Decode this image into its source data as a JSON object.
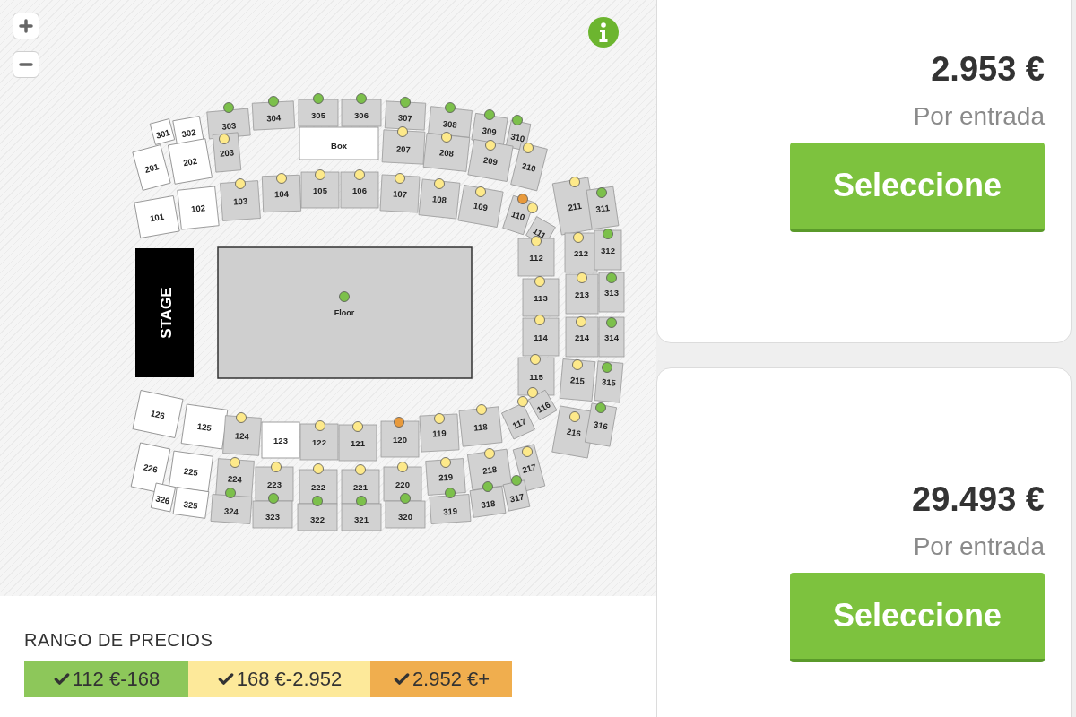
{
  "map": {
    "stage": {
      "label": "STAGE"
    },
    "floor": {
      "label": "Floor",
      "color": "#7cc04b"
    },
    "sections": [
      {
        "label": "301",
        "available": false
      },
      {
        "label": "302",
        "available": false
      },
      {
        "label": "303",
        "available": true,
        "color": "#7cc04b"
      },
      {
        "label": "304",
        "available": true,
        "color": "#7cc04b"
      },
      {
        "label": "305",
        "available": true,
        "color": "#7cc04b"
      },
      {
        "label": "306",
        "available": true,
        "color": "#7cc04b"
      },
      {
        "label": "307",
        "available": true,
        "color": "#7cc04b"
      },
      {
        "label": "308",
        "available": true,
        "color": "#7cc04b"
      },
      {
        "label": "309",
        "available": true,
        "color": "#7cc04b"
      },
      {
        "label": "310",
        "available": true,
        "color": "#7cc04b"
      },
      {
        "label": "201",
        "available": false
      },
      {
        "label": "202",
        "available": false
      },
      {
        "label": "203",
        "available": true,
        "color": "#fde98a"
      },
      {
        "label": "Box",
        "available": false
      },
      {
        "label": "207",
        "available": true,
        "color": "#fde98a"
      },
      {
        "label": "208",
        "available": true,
        "color": "#fde98a"
      },
      {
        "label": "209",
        "available": true,
        "color": "#fde98a"
      },
      {
        "label": "210",
        "available": true,
        "color": "#fde98a"
      },
      {
        "label": "101",
        "available": false
      },
      {
        "label": "102",
        "available": false
      },
      {
        "label": "103",
        "available": true,
        "color": "#fde98a"
      },
      {
        "label": "104",
        "available": true,
        "color": "#fde98a"
      },
      {
        "label": "105",
        "available": true,
        "color": "#fde98a"
      },
      {
        "label": "106",
        "available": true,
        "color": "#fde98a"
      },
      {
        "label": "107",
        "available": true,
        "color": "#fde98a"
      },
      {
        "label": "108",
        "available": true,
        "color": "#fde98a"
      },
      {
        "label": "109",
        "available": true,
        "color": "#fde98a"
      },
      {
        "label": "110",
        "available": true,
        "color": "#e89a3c"
      },
      {
        "label": "111",
        "available": true,
        "color": "#fde98a"
      },
      {
        "label": "112",
        "available": true,
        "color": "#fde98a"
      },
      {
        "label": "113",
        "available": true,
        "color": "#fde98a"
      },
      {
        "label": "114",
        "available": true,
        "color": "#fde98a"
      },
      {
        "label": "115",
        "available": true,
        "color": "#fde98a"
      },
      {
        "label": "116",
        "available": true,
        "color": "#fde98a"
      },
      {
        "label": "117",
        "available": true,
        "color": "#fde98a"
      },
      {
        "label": "211",
        "available": true,
        "color": "#fde98a"
      },
      {
        "label": "212",
        "available": true,
        "color": "#fde98a"
      },
      {
        "label": "213",
        "available": true,
        "color": "#fde98a"
      },
      {
        "label": "214",
        "available": true,
        "color": "#fde98a"
      },
      {
        "label": "215",
        "available": true,
        "color": "#fde98a"
      },
      {
        "label": "216",
        "available": true,
        "color": "#fde98a"
      },
      {
        "label": "311",
        "available": true,
        "color": "#7cc04b"
      },
      {
        "label": "312",
        "available": true,
        "color": "#7cc04b"
      },
      {
        "label": "313",
        "available": true,
        "color": "#7cc04b"
      },
      {
        "label": "314",
        "available": true,
        "color": "#7cc04b"
      },
      {
        "label": "315",
        "available": true,
        "color": "#7cc04b"
      },
      {
        "label": "316",
        "available": true,
        "color": "#7cc04b"
      },
      {
        "label": "126",
        "available": false
      },
      {
        "label": "125",
        "available": false
      },
      {
        "label": "124",
        "available": true,
        "color": "#fde98a"
      },
      {
        "label": "123",
        "available": false
      },
      {
        "label": "122",
        "available": true,
        "color": "#fde98a"
      },
      {
        "label": "121",
        "available": true,
        "color": "#fde98a"
      },
      {
        "label": "120",
        "available": true,
        "color": "#e89a3c"
      },
      {
        "label": "119",
        "available": true,
        "color": "#fde98a"
      },
      {
        "label": "118",
        "available": true,
        "color": "#fde98a"
      },
      {
        "label": "226",
        "available": false
      },
      {
        "label": "225",
        "available": false
      },
      {
        "label": "224",
        "available": true,
        "color": "#fde98a"
      },
      {
        "label": "223",
        "available": true,
        "color": "#fde98a"
      },
      {
        "label": "222",
        "available": true,
        "color": "#fde98a"
      },
      {
        "label": "221",
        "available": true,
        "color": "#fde98a"
      },
      {
        "label": "220",
        "available": true,
        "color": "#fde98a"
      },
      {
        "label": "219",
        "available": true,
        "color": "#fde98a"
      },
      {
        "label": "218",
        "available": true,
        "color": "#fde98a"
      },
      {
        "label": "217",
        "available": true,
        "color": "#fde98a"
      },
      {
        "label": "326",
        "available": false
      },
      {
        "label": "325",
        "available": false
      },
      {
        "label": "324",
        "available": true,
        "color": "#7cc04b"
      },
      {
        "label": "323",
        "available": true,
        "color": "#7cc04b"
      },
      {
        "label": "322",
        "available": true,
        "color": "#7cc04b"
      },
      {
        "label": "321",
        "available": true,
        "color": "#7cc04b"
      },
      {
        "label": "320",
        "available": true,
        "color": "#7cc04b"
      },
      {
        "label": "319",
        "available": true,
        "color": "#7cc04b"
      },
      {
        "label": "318",
        "available": true,
        "color": "#7cc04b"
      },
      {
        "label": "317",
        "available": true,
        "color": "#7cc04b"
      }
    ]
  },
  "legend": {
    "title": "RANGO DE PRECIOS",
    "items": [
      {
        "label": "112 €-168",
        "color": "#8dc75a",
        "checked": true
      },
      {
        "label": "168 €-2.952",
        "color": "#fde99a",
        "checked": true
      },
      {
        "label": "2.952 €+",
        "color": "#f0ae4e",
        "checked": true
      }
    ]
  },
  "offers": [
    {
      "price": "2.953 €",
      "unit": "Por entrada",
      "button": "Seleccione"
    },
    {
      "price": "29.493 €",
      "unit": "Por entrada",
      "button": "Seleccione"
    }
  ]
}
